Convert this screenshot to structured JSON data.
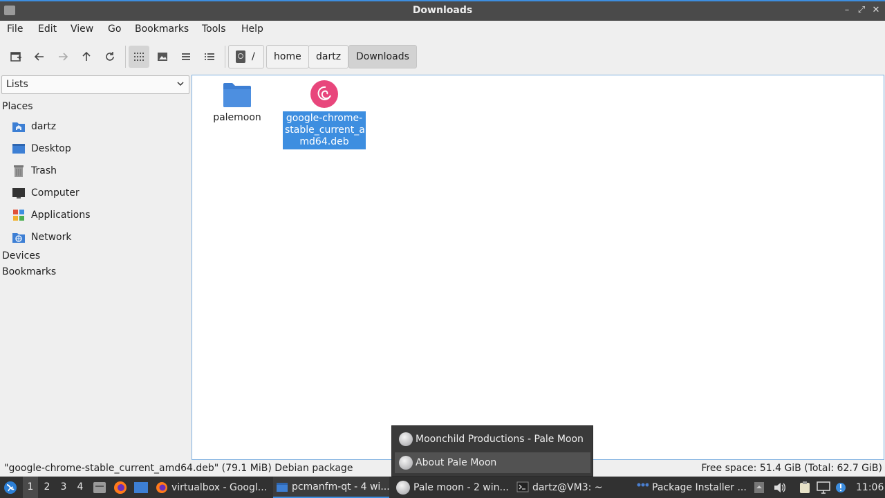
{
  "window": {
    "title": "Downloads"
  },
  "menu": {
    "file": "File",
    "edit": "Edit",
    "view": "View",
    "go": "Go",
    "bookmarks": "Bookmarks",
    "tools": "Tools",
    "help": "Help"
  },
  "breadcrumb": {
    "root": "/",
    "home": "home",
    "user": "dartz",
    "current": "Downloads"
  },
  "sidebar": {
    "combo": "Lists",
    "places_header": "Places",
    "places": [
      {
        "label": "dartz",
        "icon": "home-folder-icon"
      },
      {
        "label": "Desktop",
        "icon": "desktop-icon"
      },
      {
        "label": "Trash",
        "icon": "trash-icon"
      },
      {
        "label": "Computer",
        "icon": "computer-icon"
      },
      {
        "label": "Applications",
        "icon": "applications-icon"
      },
      {
        "label": "Network",
        "icon": "network-icon"
      }
    ],
    "devices_header": "Devices",
    "bookmarks_header": "Bookmarks"
  },
  "files": [
    {
      "name": "palemoon",
      "icon": "folder-icon",
      "selected": false
    },
    {
      "name_line1": "google-chrome-",
      "name_line2": "stable_current_a",
      "name_line3": "md64.deb",
      "icon": "debian-package-icon",
      "selected": true
    }
  ],
  "status": {
    "left": "\"google-chrome-stable_current_amd64.deb\" (79.1 MiB) Debian package",
    "right": "Free space: 51.4 GiB (Total: 62.7 GiB)"
  },
  "popup": {
    "items": [
      "Moonchild Productions - Pale Moon",
      "About Pale Moon"
    ]
  },
  "taskbar": {
    "desktops": [
      "1",
      "2",
      "3",
      "4"
    ],
    "tasks": [
      "virtualbox - Googl...",
      "pcmanfm-qt - 4 wi...",
      "Pale moon - 2 win...",
      "dartz@VM3: ~",
      "Package Installer ..."
    ],
    "clock": "11:06"
  },
  "colors": {
    "accent": "#3d8ee0",
    "selection": "#3d8ee0",
    "taskbar": "#313131"
  }
}
